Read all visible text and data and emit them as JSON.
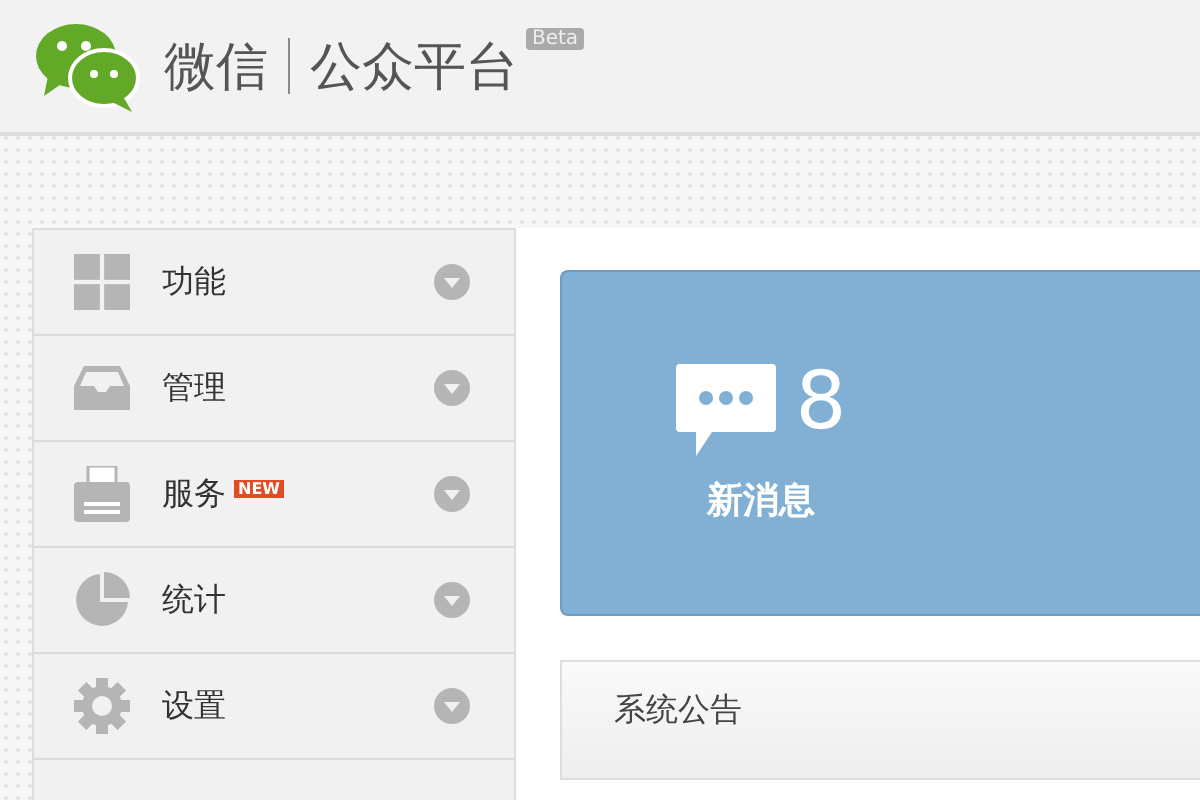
{
  "header": {
    "brand": "微信",
    "product": "公众平台",
    "tag": "Beta"
  },
  "sidebar": {
    "items": [
      {
        "label": "功能"
      },
      {
        "label": "管理"
      },
      {
        "label": "服务",
        "badge": "NEW"
      },
      {
        "label": "统计"
      },
      {
        "label": "设置"
      }
    ]
  },
  "message_card": {
    "count": "8",
    "label": "新消息"
  },
  "notice_panel": {
    "title": "系统公告"
  }
}
